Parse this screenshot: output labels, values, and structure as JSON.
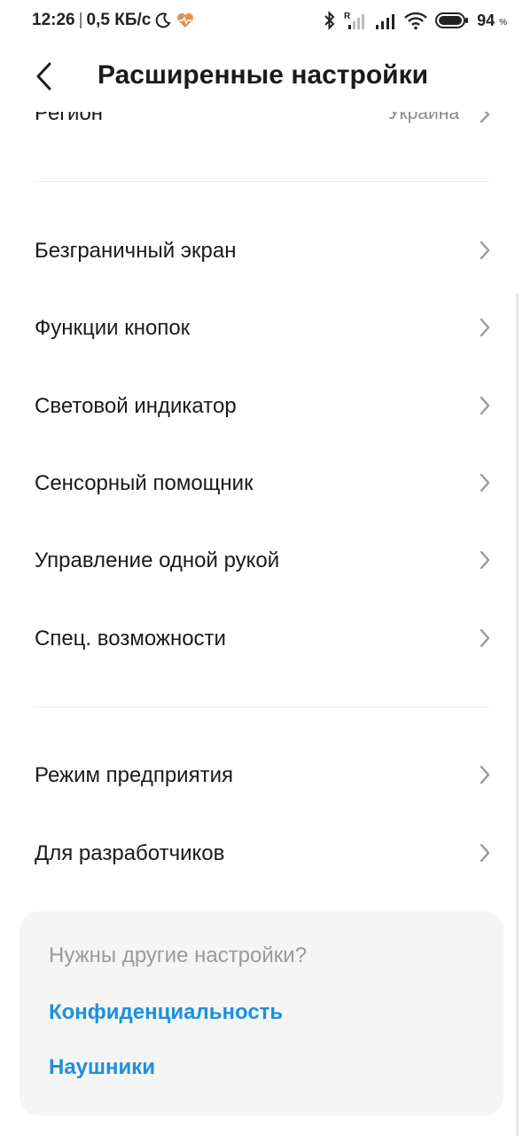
{
  "status_bar": {
    "time": "12:26",
    "separator": "|",
    "speed": "0,5 КБ/с",
    "battery_level": "94",
    "battery_unit": "%",
    "icons": [
      "moon-icon",
      "heart-rate-icon",
      "bluetooth-icon",
      "signal-icon",
      "signal-icon",
      "wifi-icon",
      "battery-icon"
    ]
  },
  "header": {
    "title": "Расширенные настройки"
  },
  "partial_row": {
    "label": "Регион",
    "value": "Украина"
  },
  "group1": [
    {
      "label": "Безграничный экран"
    },
    {
      "label": "Функции кнопок"
    },
    {
      "label": "Световой индикатор"
    },
    {
      "label": "Сенсорный помощник"
    },
    {
      "label": "Управление одной рукой"
    },
    {
      "label": "Спец. возможности"
    }
  ],
  "group2": [
    {
      "label": "Режим предприятия"
    },
    {
      "label": "Для разработчиков"
    }
  ],
  "suggestions": {
    "title": "Нужны другие настройки?",
    "links": [
      "Конфиденциальность",
      "Наушники"
    ]
  },
  "colors": {
    "link": "#1d8fe0",
    "heart": "#e0905a",
    "card_bg": "#f5f5f5"
  }
}
